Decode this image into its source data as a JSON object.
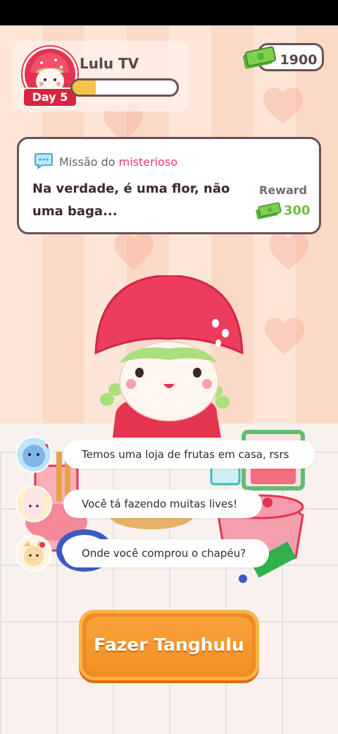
{
  "profile": {
    "username": "Lulu TV",
    "day_badge": "Day 5",
    "progress": 0.22
  },
  "currency": {
    "amount": "1900",
    "icon": "cash-icon"
  },
  "mission": {
    "title_prefix": "Missão do",
    "title_highlight": "misterioso",
    "text": "Na verdade, é uma flor, não uma baga...",
    "reward_label": "Reward",
    "reward_value": "300",
    "icon": "chat-bubble-icon"
  },
  "chat": [
    {
      "text": "Temos uma loja de frutas em casa, rsrs"
    },
    {
      "text": "Você tá fazendo muitas lives!"
    },
    {
      "text": "Onde você comprou o chapéu?"
    }
  ],
  "actions": {
    "main_button": "Fazer Tanghulu"
  },
  "colors": {
    "accent": "#f08a1f",
    "hat": "#e5344f",
    "reward_green": "#6fbf3a",
    "highlight_pink": "#e43c6a"
  }
}
